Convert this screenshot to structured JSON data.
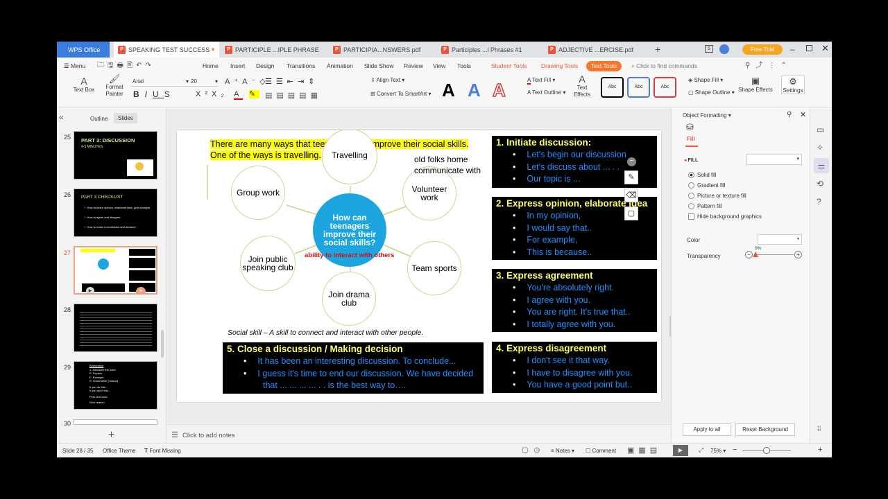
{
  "tabs": {
    "app": "WPS Office",
    "items": [
      {
        "label": "SPEAKING TEST SUCCESS"
      },
      {
        "label": "PARTICIPLE ...IPLE PHRASE"
      },
      {
        "label": "PARTICIPIA...NSWERS.pdf"
      },
      {
        "label": "Participles ...l Phrases #1"
      },
      {
        "label": "ADJECTIVE ...ERCISE.pdf"
      }
    ],
    "free_trial": "Free Trial"
  },
  "menu": {
    "main": "Menu",
    "items": [
      "Home",
      "Insert",
      "Design",
      "Transitions",
      "Animation",
      "Slide Show",
      "Review",
      "View",
      "Tools"
    ],
    "student_tools": "Student Tools",
    "drawing_tools": "Drawing Tools",
    "text_tools": "Text Tools",
    "search_placeholder": "Click to find commands"
  },
  "ribbon": {
    "text_box": "Text Box",
    "format_painter": "Format Painter",
    "font": "Arial",
    "font_size": "20",
    "align_text": "Align Text",
    "convert_smartart": "Convert To SmartArt",
    "text_fill": "Text Fill",
    "text_outline": "Text Outline",
    "text_effects": "Text Effects",
    "shape_fill": "Shape Fill",
    "shape_outline": "Shape Outline",
    "shape_effects": "Shape Effects",
    "settings": "Settings",
    "style_sample": "Abc",
    "big_a": "A"
  },
  "left_panel": {
    "outline_tab": "Outline",
    "slides_tab": "Slides",
    "thumbs": [
      {
        "num": "25",
        "title": "PART 3: DISCUSSION",
        "sub": "4-5 MINUTES"
      },
      {
        "num": "26",
        "title": "PART 3 CHECKLIST",
        "lines": [
          "How to share opinion, elaborate idea, give example",
          "How to agree and disagree",
          "How to make a conclusion and decision"
        ]
      },
      {
        "num": "27"
      },
      {
        "num": "28"
      },
      {
        "num": "29",
        "lines": [
          "Elaboration",
          "1. Introduce the point",
          "E. Explain",
          "E. Example",
          "S. Summarise (reason)",
          "If you do this...",
          "If you don't this...",
          "Pros and cons",
          "Give reason"
        ]
      },
      {
        "num": "30"
      }
    ]
  },
  "slide": {
    "intro_line1": "There are many ways that teenagers can improve their social skills.",
    "intro_line2": "One of the ways is travelling.",
    "annotation1": "old folks home",
    "annotation2": "communicate with",
    "center": "How can teenagers improve their social skills?",
    "ability": "ability to interact with others",
    "nodes": [
      "Travelling",
      "Group work",
      "Volunteer work",
      "Join public speaking club",
      "Team sports",
      "Join drama club"
    ],
    "definition": "Social skill – A skill to connect and interact with other people.",
    "boxes": [
      {
        "title": "1. Initiate discussion:",
        "items": [
          "Let's begin our discussion",
          "Let's discuss about ... . .",
          "Our topic is ..."
        ]
      },
      {
        "title": "2. Express opinion, elaborate idea",
        "items": [
          "In my opinion,",
          "I would say that..",
          "For example,",
          "This is because.."
        ]
      },
      {
        "title": "3. Express agreement",
        "items": [
          "You're absolutely right.",
          "I agree with you.",
          "You are right. It's true that..",
          "I totally agree with you."
        ]
      },
      {
        "title": "4. Express disagreement",
        "items": [
          "I don't see it that way.",
          "I have to disagree with you.",
          "You have a good point but.."
        ]
      },
      {
        "title": "5. Close a discussion / Making decision",
        "items": [
          "It has been an interesting discussion. To conclude...",
          "I guess it's time to end our discussion. We have decided that ... ... ... ... . . is the best way to…."
        ]
      }
    ]
  },
  "notes_placeholder": "Click to add notes",
  "right_panel": {
    "title": "Object Formatting",
    "fill_tab": "Fill",
    "fill_section": "FILL",
    "options": [
      "Solid fill",
      "Gradient fill",
      "Picture or texture fill",
      "Pattern fill"
    ],
    "hide_bg": "Hide background graphics",
    "color_label": "Color",
    "transparency_label": "Transparency",
    "transparency_value": "0%",
    "apply_all": "Apply to all",
    "reset_bg": "Reset Background"
  },
  "status": {
    "slide_info": "Slide 28 / 35",
    "theme": "Office Theme",
    "font_missing": "Font Missing",
    "notes": "Notes",
    "comment": "Comment",
    "zoom": "75%"
  },
  "colors": {
    "accent": "#e8553c",
    "text_tools_bg": "#f5772a",
    "node_border": "#c9d38f",
    "center_blue": "#1da5e0",
    "list_blue": "#1e90ff",
    "heading_yellow": "#ffff66",
    "highlight": "#ffff00"
  }
}
